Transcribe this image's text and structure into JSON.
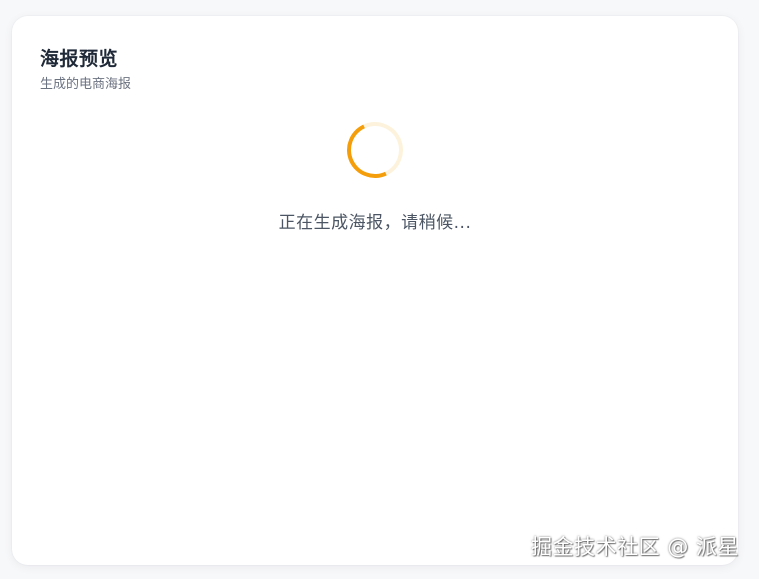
{
  "card": {
    "title": "海报预览",
    "subtitle": "生成的电商海报"
  },
  "loading": {
    "text": "正在生成海报，请稍候...",
    "spinner_color": "#f59e0b",
    "spinner_track_color": "#fdf3dc"
  },
  "watermark": {
    "text": "掘金技术社区 @ 派星"
  },
  "colors": {
    "page_background": "#f7f8fa",
    "card_background": "#ffffff",
    "title": "#1f2937",
    "subtitle": "#6b7280"
  }
}
